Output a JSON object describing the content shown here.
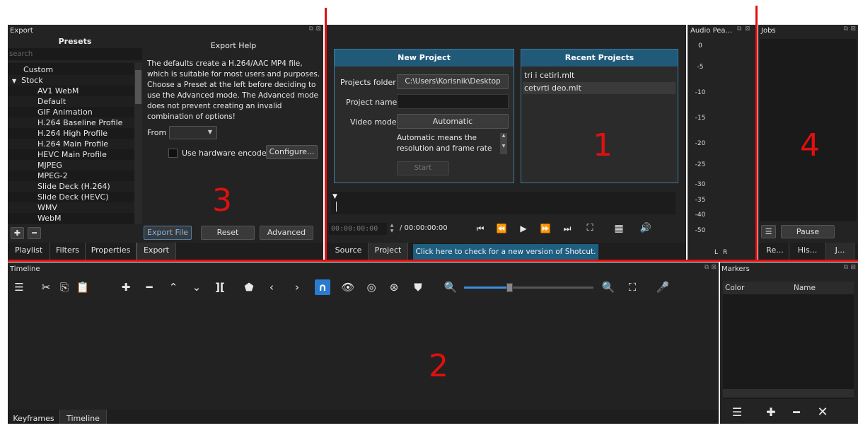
{
  "export": {
    "title": "Export",
    "presets_header": "Presets",
    "search_placeholder": "search",
    "presets": [
      "Custom",
      "Stock",
      "AV1 WebM",
      "Default",
      "GIF Animation",
      "H.264 Baseline Profile",
      "H.264 High Profile",
      "H.264 Main Profile",
      "HEVC Main Profile",
      "MJPEG",
      "MPEG-2",
      "Slide Deck (H.264)",
      "Slide Deck (HEVC)",
      "WMV",
      "WebM"
    ],
    "help_title": "Export Help",
    "help_text": "The defaults create a H.264/AAC MP4 file, which is suitable for most users and purposes. Choose a Preset at the left before deciding to use the Advanced mode. The Advanced mode does not prevent creating an invalid combination of options!",
    "from_label": "From",
    "hw_encoder_label": "Use hardware encoder",
    "configure_button": "Configure...",
    "export_file_button": "Export File",
    "reset_button": "Reset",
    "advanced_button": "Advanced"
  },
  "left_tabs": [
    "Playlist",
    "Filters",
    "Properties",
    "Export"
  ],
  "start_page": {
    "new_project_title": "New Project",
    "projects_folder_label": "Projects folder",
    "projects_folder_value": "C:\\Users\\Korisnik\\Desktop",
    "project_name_label": "Project name",
    "project_name_value": "",
    "video_mode_label": "Video mode",
    "video_mode_value": "Automatic",
    "video_mode_help": "Automatic means the resolution and frame rate are",
    "start_button": "Start",
    "recent_title": "Recent Projects",
    "recent_items": [
      "tri i cetiri.mlt",
      "cetvrti deo.mlt"
    ]
  },
  "player": {
    "timecode": "00:00:00:00",
    "duration": "/ 00:00:00:00",
    "tabs": [
      "Source",
      "Project"
    ],
    "update_notice": "Click here to check for a new version of Shotcut."
  },
  "audio": {
    "title": "Audio Pea...",
    "scale": [
      "0",
      "-5",
      "-10",
      "-15",
      "-20",
      "-25",
      "-30",
      "-35",
      "-40",
      "-50"
    ],
    "channels": [
      "L",
      "R"
    ]
  },
  "jobs": {
    "title": "Jobs",
    "pause_button": "Pause",
    "tabs": [
      "Re...",
      "His...",
      "J..."
    ]
  },
  "timeline": {
    "title": "Timeline",
    "tabs": [
      "Keyframes",
      "Timeline"
    ]
  },
  "markers": {
    "title": "Markers",
    "columns": [
      "Color",
      "Name"
    ]
  },
  "annotations": [
    "1",
    "2",
    "3",
    "4"
  ]
}
